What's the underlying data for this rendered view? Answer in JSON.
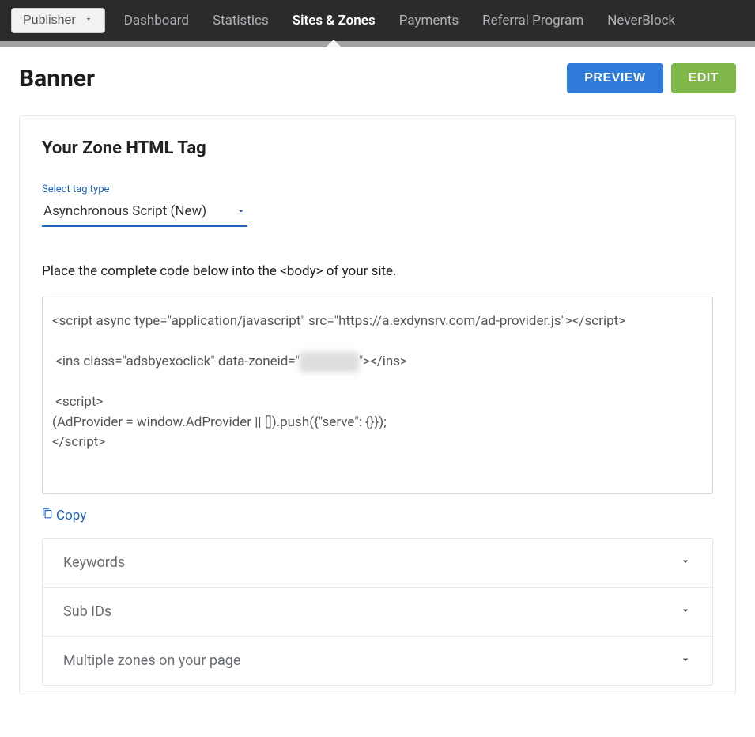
{
  "nav": {
    "role_label": "Publisher",
    "items": [
      {
        "label": "Dashboard",
        "active": false
      },
      {
        "label": "Statistics",
        "active": false
      },
      {
        "label": "Sites & Zones",
        "active": true
      },
      {
        "label": "Payments",
        "active": false
      },
      {
        "label": "Referral Program",
        "active": false
      },
      {
        "label": "NeverBlock",
        "active": false
      }
    ]
  },
  "page": {
    "title": "Banner",
    "actions": {
      "preview": "PREVIEW",
      "edit": "EDIT"
    }
  },
  "zone": {
    "section_title": "Your Zone HTML Tag",
    "select_label": "Select tag type",
    "select_value": "Asynchronous Script (New)",
    "instructions": "Place the complete code below into the <body> of your site.",
    "code_lines": {
      "l1": "<script async type=\"application/javascript\" src=\"https://a.exdynsrv.com/ad-provider.js\"></script>",
      "l2_pre": " <ins class=\"adsbyexoclick\" data-zoneid=\"",
      "l2_blur": "XXXXXXX",
      "l2_post": "\"></ins>",
      "l3": " <script>",
      "l4": "(AdProvider = window.AdProvider || []).push({\"serve\": {}});",
      "l5": "</script>"
    },
    "copy_label": "Copy"
  },
  "accordion": {
    "items": [
      {
        "label": "Keywords"
      },
      {
        "label": "Sub IDs"
      },
      {
        "label": "Multiple zones on your page"
      }
    ]
  }
}
